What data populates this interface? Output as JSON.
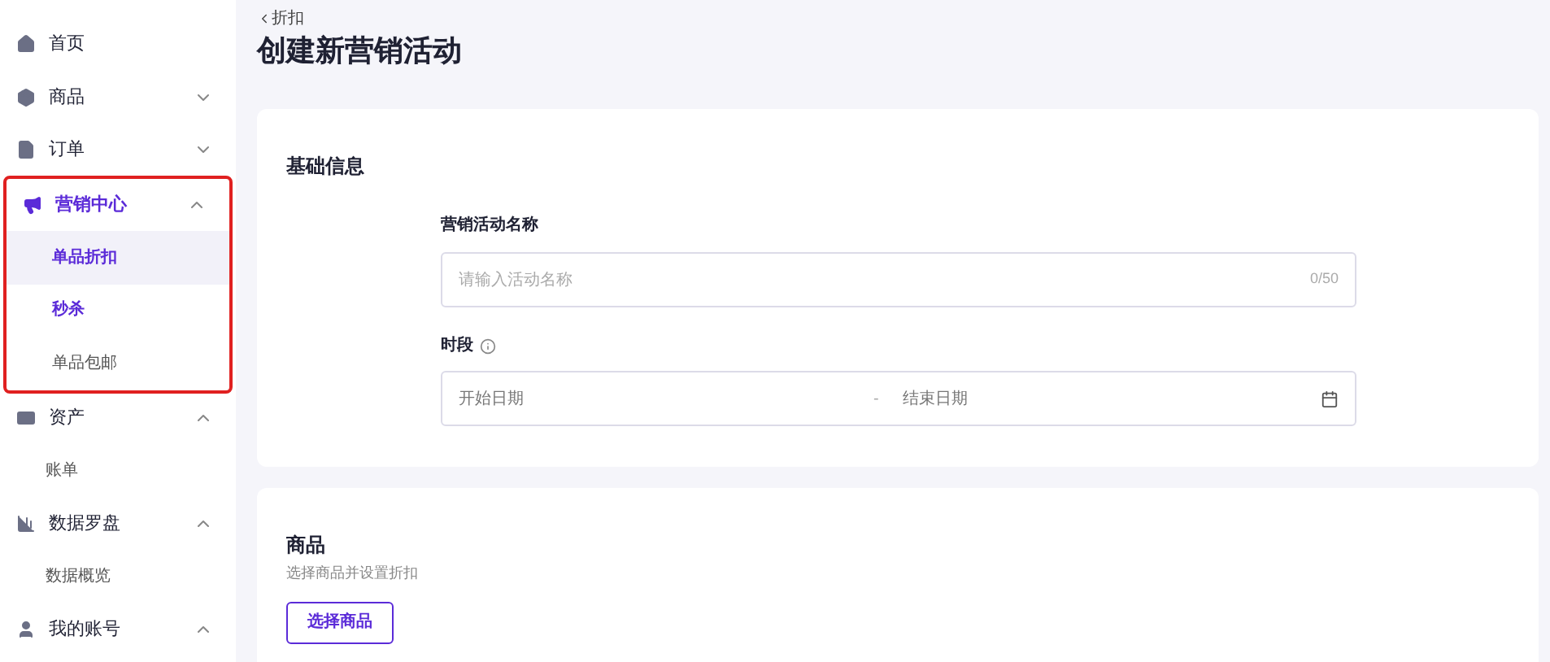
{
  "sidebar": {
    "items": [
      {
        "label": "首页"
      },
      {
        "label": "商品",
        "expanded": false
      },
      {
        "label": "订单",
        "expanded": false
      },
      {
        "label": "营销中心",
        "expanded": true,
        "selected": true,
        "annotated": true,
        "children": [
          {
            "label": "单品折扣",
            "selected": true,
            "emphasized": true
          },
          {
            "label": "秒杀",
            "selected": false,
            "emphasized": true
          },
          {
            "label": "单品包邮",
            "selected": false,
            "emphasized": false
          }
        ]
      },
      {
        "label": "资产",
        "expanded": true,
        "children": [
          {
            "label": "账单",
            "selected": false,
            "emphasized": false
          }
        ]
      },
      {
        "label": "数据罗盘",
        "expanded": true,
        "children": [
          {
            "label": "数据概览",
            "selected": false,
            "emphasized": false
          }
        ]
      },
      {
        "label": "我的账号",
        "expanded": true
      }
    ]
  },
  "breadcrumb": "折扣",
  "title": "创建新营销活动",
  "basic_info": {
    "heading": "基础信息",
    "name_label": "营销活动名称",
    "name_placeholder": "请输入活动名称",
    "name_counter": "0/50",
    "period_label": "时段",
    "start_placeholder": "开始日期",
    "separator": "-",
    "end_placeholder": "结束日期"
  },
  "products": {
    "heading": "商品",
    "subtitle": "选择商品并设置折扣",
    "button": "选择商品"
  }
}
